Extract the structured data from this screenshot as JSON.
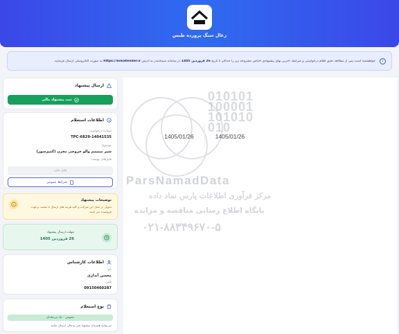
{
  "header": {
    "title": "زغال سنگ پرورده طبس",
    "logo_icon": "house-logo-icon"
  },
  "notice": {
    "text_before": "خواهشمند است پس از مطالعه دقیق اقلام درخواستی و شرایط، آخرین بهای پیشنهادی اجناس مشروحه زیر را حداکثر تا تاریخ",
    "deadline": "26 فروردین 1405",
    "text_middle": "در سامانه سیمانتندر به آدرس",
    "url": "https://Simatender.ir",
    "text_after": "به صورت الکترونیکی ارسال فرمایید."
  },
  "main": {
    "dates": [
      "1405/01/26",
      "1405/01/26"
    ]
  },
  "watermark": {
    "digits": [
      "010101",
      "100001",
      "101010",
      "010"
    ],
    "brand": "ParsNamadData",
    "line1": "مرکز فرآوری اطلاعات پارس نماد داده",
    "line2": "پایگاه اطلاع رسانی مناقصه و مزایده",
    "phone": "۰۲۱-۸۸۳۴۹۶۷۰-۵"
  },
  "send_offer": {
    "title": "ارسال پیشنهاد",
    "button": "ثبت پیشنهاد مالی"
  },
  "inquiry": {
    "title": "اطلاعات استعلام",
    "number_label": "شماره درخواست:",
    "number_value": "TPC-6829-14041535",
    "subject_label": "موضوع:",
    "subject_value": "شیر مینیمم والو خروجی مخزن (کمپرسور)",
    "attachments_label": "فایل‌های پیوست:",
    "no_file": "فایل ندارد",
    "terms_button": "شرایط عمومی"
  },
  "buyer_notes": {
    "title": "توضیحات پیشنهاد",
    "text": "تحویل در محل این شرکت و کلیه هزینه های ارسال تا مقصد برعهده فروشنده می باشد."
  },
  "deadline_card": {
    "label": "مهلت ارسال پیشنهاد",
    "value": "26 فروردین 1405"
  },
  "expert": {
    "title": "اطلاعات کارشناس",
    "name_label": "نام:",
    "name_value": "محسن آبداری",
    "phone_label": "تلفن:",
    "phone_value": "09150460287"
  },
  "inquiry_type": {
    "title": "نوع استعلام",
    "badge": "عمومی - تک مرحله‌ای",
    "text": "می‌توانید همزمان پیشنهاد فنی و مالی ارسال نمایید"
  },
  "colors": {
    "header": "#3b47e8",
    "accent_green": "#16a05b",
    "accent_blue": "#4455cc",
    "warning_bg": "#fff8e1"
  }
}
